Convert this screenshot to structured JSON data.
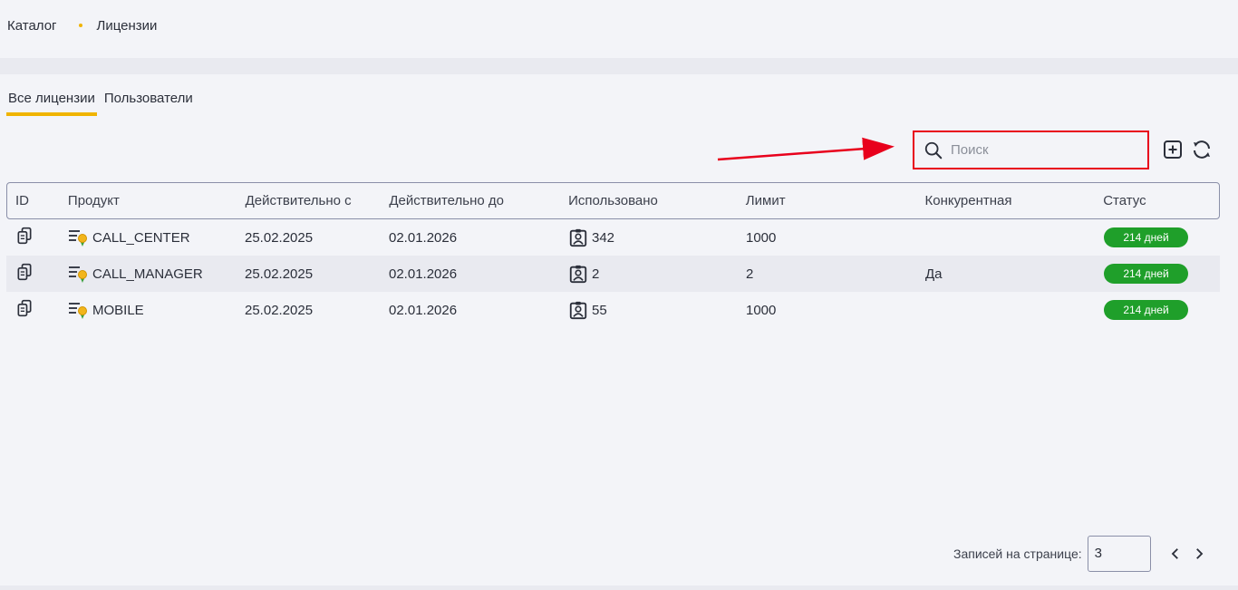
{
  "breadcrumb": {
    "items": [
      "Каталог",
      "Лицензии"
    ]
  },
  "tabs": [
    {
      "label": "Все лицензии",
      "active": true
    },
    {
      "label": "Пользователи",
      "active": false
    }
  ],
  "search": {
    "placeholder": "Поиск",
    "value": ""
  },
  "table": {
    "columns": [
      "ID",
      "Продукт",
      "Действительно с",
      "Действительно до",
      "Использовано",
      "Лимит",
      "Конкурентная",
      "Статус"
    ],
    "rows": [
      {
        "product": "CALL_CENTER",
        "from": "25.02.2025",
        "to": "02.01.2026",
        "used": "342",
        "limit": "1000",
        "concurrent": "",
        "status": "214 дней"
      },
      {
        "product": "CALL_MANAGER",
        "from": "25.02.2025",
        "to": "02.01.2026",
        "used": "2",
        "limit": "2",
        "concurrent": "Да",
        "status": "214 дней"
      },
      {
        "product": "MOBILE",
        "from": "25.02.2025",
        "to": "02.01.2026",
        "used": "55",
        "limit": "1000",
        "concurrent": "",
        "status": "214 дней"
      }
    ]
  },
  "pagination": {
    "label": "Записей на странице:",
    "per_page": "3"
  },
  "colors": {
    "accent": "#f0b400",
    "status_green": "#1f9f2a",
    "highlight": "#e8001c"
  },
  "icons": [
    "copy-icon",
    "license-icon",
    "user-badge-icon",
    "search-icon",
    "add-icon",
    "refresh-icon",
    "chevron-left-icon",
    "chevron-right-icon"
  ]
}
